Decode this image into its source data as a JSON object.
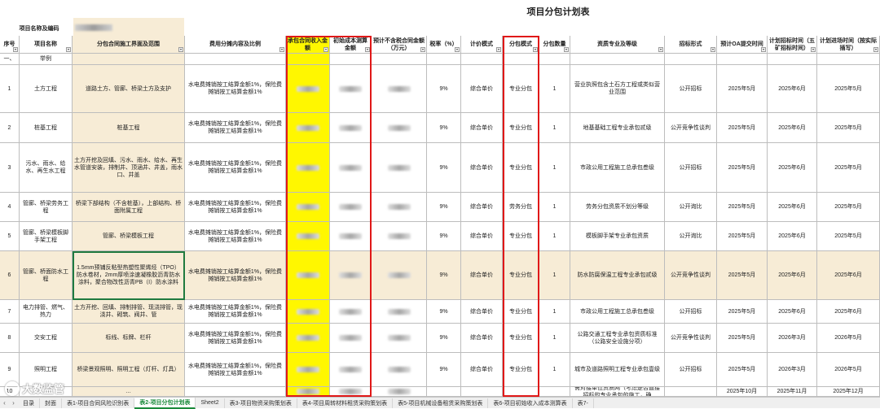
{
  "title": "项目分包计划表",
  "project_label": "项目名称及编码",
  "headers": [
    "序号",
    "项目名称",
    "分包合同施工界面及范围",
    "费用分摊内容及比例",
    "承包合同收入金额",
    "初始成本测算金额",
    "预计不含税合同金额（万元）",
    "税率（%）",
    "计价模式",
    "分包模式",
    "分包数量",
    "资质专业及等级",
    "招标形式",
    "预计OA提交时间",
    "计划招标时间（五矿招标时间）",
    "计划进场时间（按实际插写）"
  ],
  "section_row": {
    "code": "一、",
    "name": "举例"
  },
  "rows": [
    {
      "no": "1",
      "name": "土方工程",
      "scope": "道路土方、管廊、桥梁土方及支护",
      "fee": "水电费摊销按工结算金额1%，保险费摊销按工结算金额1%",
      "tax": "9%",
      "pricing": "综合单价",
      "mode": "专业分包",
      "qty": "1",
      "qual": "营业执照包含土石方工程或类似营业范围",
      "bid": "公开招标",
      "oa": "2025年5月",
      "plan_bid": "2025年6月",
      "entry": "2025年5月"
    },
    {
      "no": "2",
      "name": "桩基工程",
      "scope": "桩基工程",
      "fee": "水电费摊销按工结算金额1%，保险费摊销按工结算金额1%",
      "tax": "9%",
      "pricing": "综合单价",
      "mode": "专业分包",
      "qty": "1",
      "qual": "地基基础工程专业承包贰级",
      "bid": "公开竞争性谈判",
      "oa": "2025年5月",
      "plan_bid": "2025年6月",
      "entry": "2025年5月"
    },
    {
      "no": "3",
      "name": "污水、雨水、给水、再生水工程",
      "scope": "土方开挖及回填、污水、雨水、给水、再生水管道安装，排制井、顶涵井、井盖，雨水口、井盖",
      "fee": "水电费摊销按工结算金额1%，保险费摊销按工结算金额1%",
      "tax": "9%",
      "pricing": "综合单价",
      "mode": "专业分包",
      "qty": "1",
      "qual": "市政公用工程施工总承包叁级",
      "bid": "公开招标",
      "oa": "2025年5月",
      "plan_bid": "2025年6月",
      "entry": "2025年5月"
    },
    {
      "no": "4",
      "name": "管廊、桥梁劳务工程",
      "scope": "桥梁下部结构（不含桩基），上部结构、桥面附属工程",
      "fee": "水电费摊销按工结算金额1%，保险费摊销按工结算金额1%",
      "tax": "9%",
      "pricing": "综合单价",
      "mode": "劳务分包",
      "qty": "1",
      "qual": "劳务分包资质不划分等级",
      "bid": "公开询比",
      "oa": "2025年5月",
      "plan_bid": "2025年6月",
      "entry": "2025年5月"
    },
    {
      "no": "5",
      "name": "管廊、桥梁模板脚手架工程",
      "scope": "管廊、桥梁模板工程",
      "fee": "水电费摊销按工结算金额1%，保险费摊销按工结算金额1%",
      "tax": "9%",
      "pricing": "综合单价",
      "mode": "专业分包",
      "qty": "1",
      "qual": "模板脚手架专业承包资质",
      "bid": "公开询比",
      "oa": "2025年5月",
      "plan_bid": "2025年6月",
      "entry": "2025年5月"
    },
    {
      "no": "6",
      "name": "管廊、桥面防水工程",
      "scope": "1.5mm预铺反粘型热塑性聚烯烃（TPO）防水卷材，2mm厚喷涂速凝橡胶沥青防水涂料，聚合物改性沥青PB（I）防水涂料",
      "fee": "水电费摊销按工结算金额1%，保险费摊销按工结算金额1%",
      "tax": "9%",
      "pricing": "综合单价",
      "mode": "专业分包",
      "qty": "1",
      "qual": "防水防腐保温工程专业承包贰级",
      "bid": "公开竞争性谈判",
      "oa": "2025年5月",
      "plan_bid": "2025年6月",
      "entry": "2025年6月"
    },
    {
      "no": "7",
      "name": "电力排管、燃气、热力",
      "scope": "土方开挖、回填、排制排管、现浇排管，现浇井、砌筑、阀井、管",
      "fee": "水电费摊销按工结算金额1%，保险费摊销按工结算金额1%",
      "tax": "9%",
      "pricing": "综合单价",
      "mode": "专业分包",
      "qty": "1",
      "qual": "市政公用工程施工总承包叁级",
      "bid": "公开招标",
      "oa": "2025年5月",
      "plan_bid": "2025年6月",
      "entry": "2025年6月"
    },
    {
      "no": "8",
      "name": "交安工程",
      "scope": "标线、标牌、栏杆",
      "fee": "水电费摊销按工结算金额1%，保险费摊销按工结算金额1%",
      "tax": "9%",
      "pricing": "综合单价",
      "mode": "专业分包",
      "qty": "1",
      "qual": "公路交通工程专业承包资质标准（公路安全设施分项）",
      "bid": "公开竞争性谈判",
      "oa": "2025年5月",
      "plan_bid": "2026年3月",
      "entry": "2026年5月"
    },
    {
      "no": "9",
      "name": "照明工程",
      "scope": "桥梁景观照明、照明工程（灯杆、灯具）",
      "fee": "水电费摊销按工结算金额1%，保险费摊销按工结算金额1%",
      "tax": "9%",
      "pricing": "综合单价",
      "mode": "专业分包",
      "qty": "1",
      "qual": "城市及道路照明工程专业承包壹级",
      "bid": "公开招标",
      "oa": "2025年5月",
      "plan_bid": "2026年3月",
      "entry": "2026年5月"
    }
  ],
  "partial_row": {
    "no": "10",
    "name": "",
    "scope": "…",
    "fee": "",
    "qual": "需对接单位资质网（考虑是否直接招标的专业承包的施工，确",
    "oa": "2025年10月",
    "plan_bid": "2025年11月",
    "entry": "2025年12月"
  },
  "tabs": [
    "目录",
    "封面",
    "表1-项目合同风险识别表",
    "表2-项目分包计划表",
    "Sheet2",
    "表3-项目物资采购策划表",
    "表4-项目周转材料租赁采购策划表",
    "表5-项目机械设备租赁采购策划表",
    "表6-项目初始收入成本测算表",
    "表7-"
  ],
  "active_tab": 3,
  "watermark": "大数监管",
  "colors": {
    "highlight": "#fff700",
    "row_tint": "#f7ecd6",
    "red": "#e01818",
    "green": "#1f7a3f",
    "tab_active": "#1a8a3a"
  },
  "icons": [
    "filter-dropdown-icon",
    "tab-nav-left-icon",
    "tab-nav-right-icon",
    "watermark-logo-icon"
  ]
}
